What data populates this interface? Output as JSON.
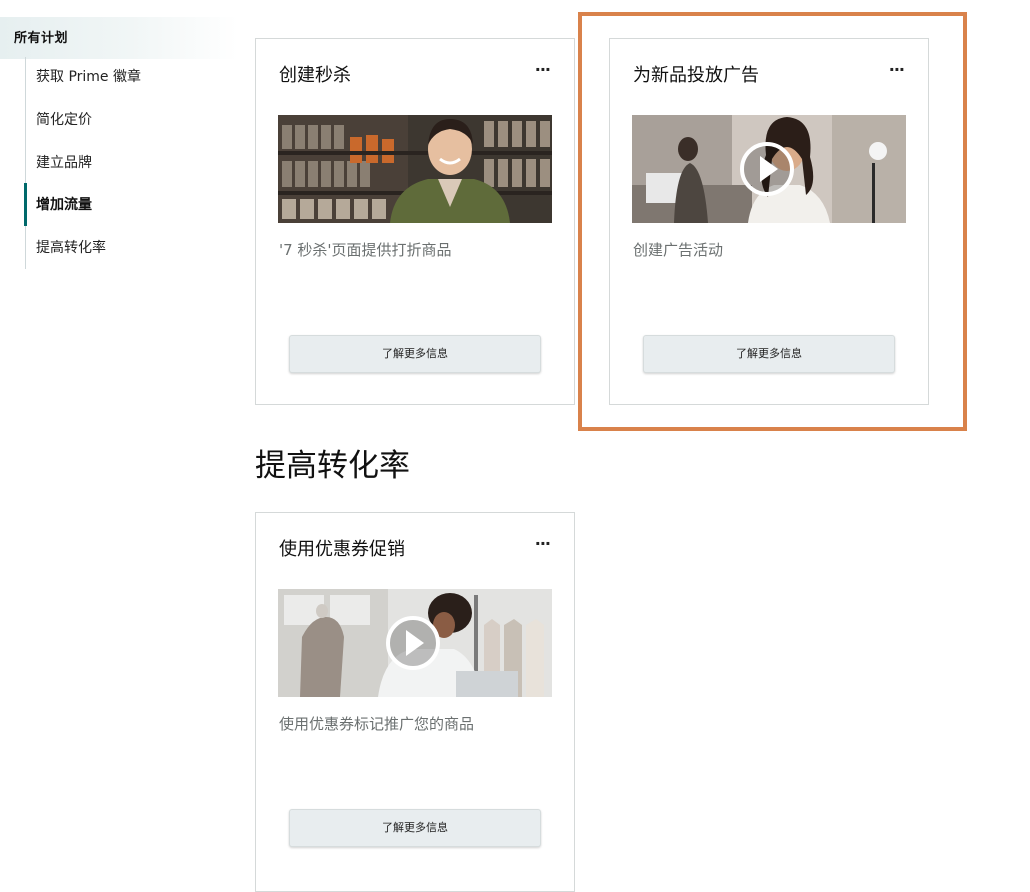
{
  "sidebar": {
    "header": "所有计划",
    "items": [
      {
        "label": "获取 Prime 徽章"
      },
      {
        "label": "简化定价"
      },
      {
        "label": "建立品牌"
      },
      {
        "label": "增加流量",
        "active": true
      },
      {
        "label": "提高转化率"
      }
    ]
  },
  "cards": [
    {
      "title": "创建秒杀",
      "menu": "···",
      "description": "'7 秒杀'页面提供打折商品",
      "button": "了解更多信息",
      "media": {
        "type": "image",
        "has_play_icon": false
      }
    },
    {
      "title": "为新品投放广告",
      "menu": "···",
      "description": "创建广告活动",
      "button": "了解更多信息",
      "media": {
        "type": "video",
        "has_play_icon": true
      }
    }
  ],
  "section": {
    "heading": "提高转化率",
    "cards": [
      {
        "title": "使用优惠券促销",
        "menu": "···",
        "description": "使用优惠券标记推广您的商品",
        "button": "了解更多信息",
        "media": {
          "type": "video",
          "has_play_icon": true
        }
      }
    ]
  },
  "colors": {
    "highlight_border": "#d9824b",
    "active_marker": "#00696b",
    "button_bg": "#e8edef",
    "card_border": "#d5d9d9"
  }
}
